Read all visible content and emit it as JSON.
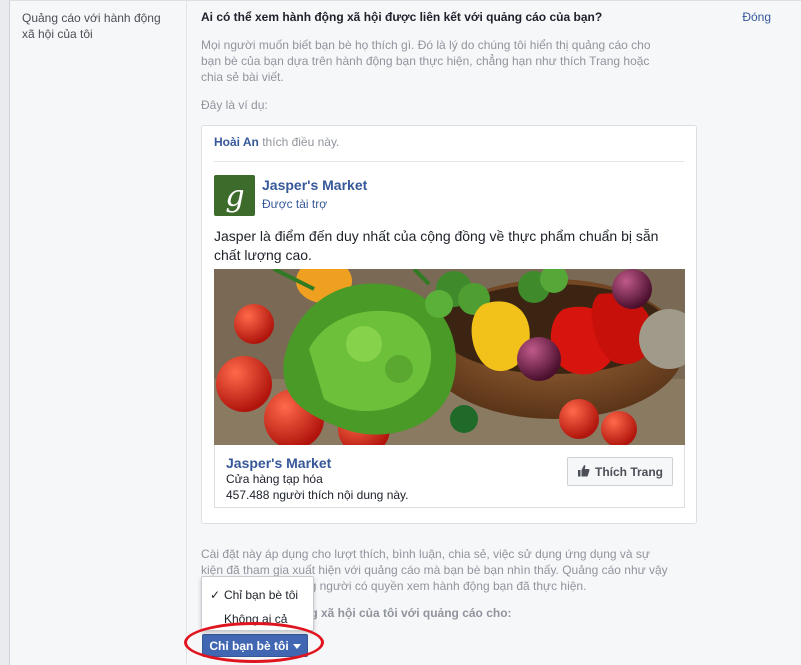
{
  "settings_row": {
    "label": "Quảng cáo với hành động xã hội của tôi",
    "close_label": "Đóng",
    "question": "Ai có thể xem hành động xã hội được liên kết với quảng cáo của bạn?",
    "description": "Mọi người muốn biết bạn bè họ thích gì. Đó là lý do chúng tôi hiển thị quảng cáo cho bạn bè của bạn dựa trên hành động bạn thực hiện, chẳng hạn như thích Trang hoặc chia sẻ bài viết.",
    "example_label": "Đây là ví dụ:"
  },
  "ad_example": {
    "friend_name": "Hoài An",
    "social_action": " thích điều này.",
    "page_name": "Jasper's Market",
    "sponsored_label": "Được tài trợ",
    "post_text": "Jasper là điểm đến duy nhất của cộng đồng về thực phẩm chuẩn bị sẵn chất lượng cao.",
    "cta_page_name": "Jasper's Market",
    "category": "Cửa hàng tạp hóa",
    "likes_text": "457.488 người thích nội dung này.",
    "like_button_label": "Thích Trang"
  },
  "settings_note": "Cài đặt này áp dụng cho lượt thích, bình luận, chia sẻ, việc sử dụng ứng dụng và sự kiện đã tham gia xuất hiện với quảng cáo mà bạn bè bạn nhìn thấy. Quảng cáo như vậy chỉ hiển thị với những người có quyền xem hành động bạn đã thực hiện.",
  "pair_label": "Ghép nối hành động xã hội của tôi với quảng cáo cho:",
  "audience_dropdown": {
    "selected": "Chỉ bạn bè tôi",
    "options": [
      {
        "label": "Chỉ bạn bè tôi",
        "checked": true
      },
      {
        "label": "Không ai cả",
        "checked": false
      }
    ]
  },
  "colors": {
    "link": "#365899",
    "button_blue": "#4267b2",
    "highlight_ring": "#e0141e",
    "logo_green": "#3d6b2c"
  }
}
